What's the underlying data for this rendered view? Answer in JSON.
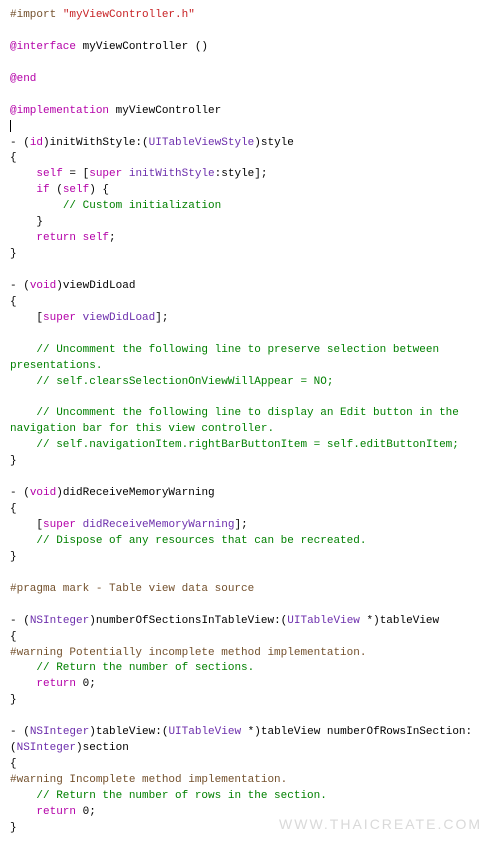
{
  "code": {
    "l1a": "#import ",
    "l1b": "\"myViewController.h\"",
    "l2a": "@interface",
    "l2b": " myViewController ()",
    "l3": "@end",
    "l4a": "@implementation",
    "l4b": " myViewController",
    "l5a": "- (",
    "l5b": "id",
    "l5c": ")initWithStyle:(",
    "l5d": "UITableViewStyle",
    "l5e": ")style",
    "l6": "{",
    "l7a": "    ",
    "l7b": "self",
    "l7c": " = [",
    "l7d": "super",
    "l7e": " ",
    "l7f": "initWithStyle",
    "l7g": ":style];",
    "l8a": "    ",
    "l8b": "if",
    "l8c": " (",
    "l8d": "self",
    "l8e": ") {",
    "l9": "        // Custom initialization",
    "l10": "    }",
    "l11a": "    ",
    "l11b": "return",
    "l11c": " ",
    "l11d": "self",
    "l11e": ";",
    "l12": "}",
    "l13a": "- (",
    "l13b": "void",
    "l13c": ")viewDidLoad",
    "l14": "{",
    "l15a": "    [",
    "l15b": "super",
    "l15c": " ",
    "l15d": "viewDidLoad",
    "l15e": "];",
    "l16": "    // Uncomment the following line to preserve selection between presentations.",
    "l17": "    // self.clearsSelectionOnViewWillAppear = NO;",
    "l18": "    // Uncomment the following line to display an Edit button in the navigation bar for this view controller.",
    "l19": "    // self.navigationItem.rightBarButtonItem = self.editButtonItem;",
    "l20": "}",
    "l21a": "- (",
    "l21b": "void",
    "l21c": ")didReceiveMemoryWarning",
    "l22": "{",
    "l23a": "    [",
    "l23b": "super",
    "l23c": " ",
    "l23d": "didReceiveMemoryWarning",
    "l23e": "];",
    "l24": "    // Dispose of any resources that can be recreated.",
    "l25": "}",
    "l26": "#pragma mark - Table view data source",
    "l27a": "- (",
    "l27b": "NSInteger",
    "l27c": ")numberOfSectionsInTableView:(",
    "l27d": "UITableView",
    "l27e": " *)tableView",
    "l28": "{",
    "l29": "#warning Potentially incomplete method implementation.",
    "l30": "    // Return the number of sections.",
    "l31a": "    ",
    "l31b": "return",
    "l31c": " ",
    "l31d": "0",
    "l31e": ";",
    "l32": "}",
    "l33a": "- (",
    "l33b": "NSInteger",
    "l33c": ")tableView:(",
    "l33d": "UITableView",
    "l33e": " *)tableView numberOfRowsInSection:(",
    "l33f": "NSInteger",
    "l33g": ")section",
    "l34": "{",
    "l35": "#warning Incomplete method implementation.",
    "l36": "    // Return the number of rows in the section.",
    "l37a": "    ",
    "l37b": "return",
    "l37c": " ",
    "l37d": "0",
    "l37e": ";",
    "l38": "}"
  },
  "watermark": "WWW.THAICREATE.COM"
}
